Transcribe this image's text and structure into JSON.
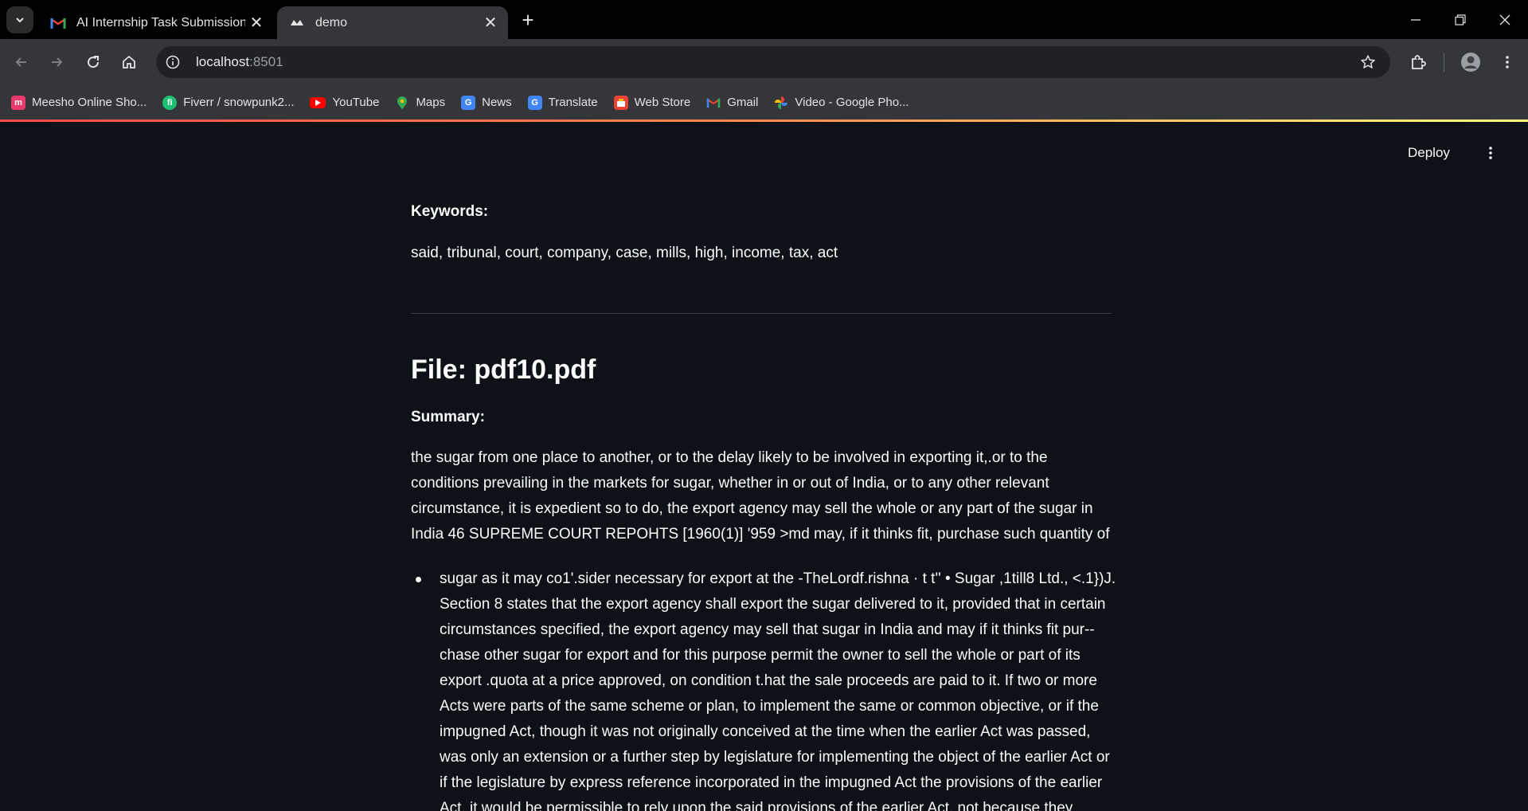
{
  "browser": {
    "tabs": [
      {
        "title": "AI Internship Task Submission fo",
        "active": false,
        "icon": "gmail-icon"
      },
      {
        "title": "demo",
        "active": true,
        "icon": "streamlit-icon"
      }
    ],
    "url_host": "localhost",
    "url_port": ":8501",
    "bookmarks": [
      {
        "label": "Meesho Online Sho...",
        "icon": "meesho-icon",
        "color": "#e8396b"
      },
      {
        "label": "Fiverr / snowpunk2...",
        "icon": "fiverr-icon",
        "color": "#1dbf73"
      },
      {
        "label": "YouTube",
        "icon": "youtube-icon",
        "color": "#ff0000"
      },
      {
        "label": "Maps",
        "icon": "maps-icon",
        "color": "#34a853"
      },
      {
        "label": "News",
        "icon": "news-icon",
        "color": "#4285f4"
      },
      {
        "label": "Translate",
        "icon": "translate-icon",
        "color": "#4285f4"
      },
      {
        "label": "Web Store",
        "icon": "webstore-icon",
        "color": "#ea4335"
      },
      {
        "label": "Gmail",
        "icon": "gmail-icon",
        "color": "#ea4335"
      },
      {
        "label": "Video - Google Pho...",
        "icon": "photos-icon",
        "color": "#fbbc04"
      }
    ]
  },
  "app": {
    "deploy_label": "Deploy",
    "keywords_label": "Keywords:",
    "keywords": "said, tribunal, court, company, case, mills, high, income, tax, act",
    "file_title": "File: pdf10.pdf",
    "summary_label": "Summary:",
    "summary_para": [
      "the sugar from one place to another, or to the delay likely to be involved in exporting it,.or to the",
      "conditions prevailing in the markets for sugar, whether in or out of India, or to any other relevant",
      "circumstance, it is expedient so to do, the export agency may sell the whole or any part of the sugar in",
      "India 46 SUPREME COURT REPOHTS [1960(1)] '959 >md may, if it thinks fit, purchase such quantity of"
    ],
    "bullet_lines": [
      "sugar as it may co1'.sider necessary for export at the -TheLordf.rishna · t t'' • Sugar ,1till8 Ltd., <.1})J.",
      "Section 8 states that the export agency shall export the sugar delivered to it, provided that in certain",
      "circumstances specified, the export agency may sell that sugar in India and may if it thinks fit pur--",
      "chase other sugar for export and for this purpose permit the owner to sell the whole or part of its",
      "export .quota at a price approved, on condition t.hat the sale proceeds are paid to it. If two or more",
      "Acts were parts of the same scheme or plan, to implement the same or common objective, or if the",
      "impugned Act, though it was not originally conceived at the time when the earlier Act was passed,",
      "was only an extension or a further step by legislature for implementing the object of the earlier Act or",
      "if the legislature by express reference incorporated in the impugned Act the provisions of the earlier",
      "Act, it would be permissible to rely upon the said provisions of the earlier Act, not because they"
    ]
  }
}
